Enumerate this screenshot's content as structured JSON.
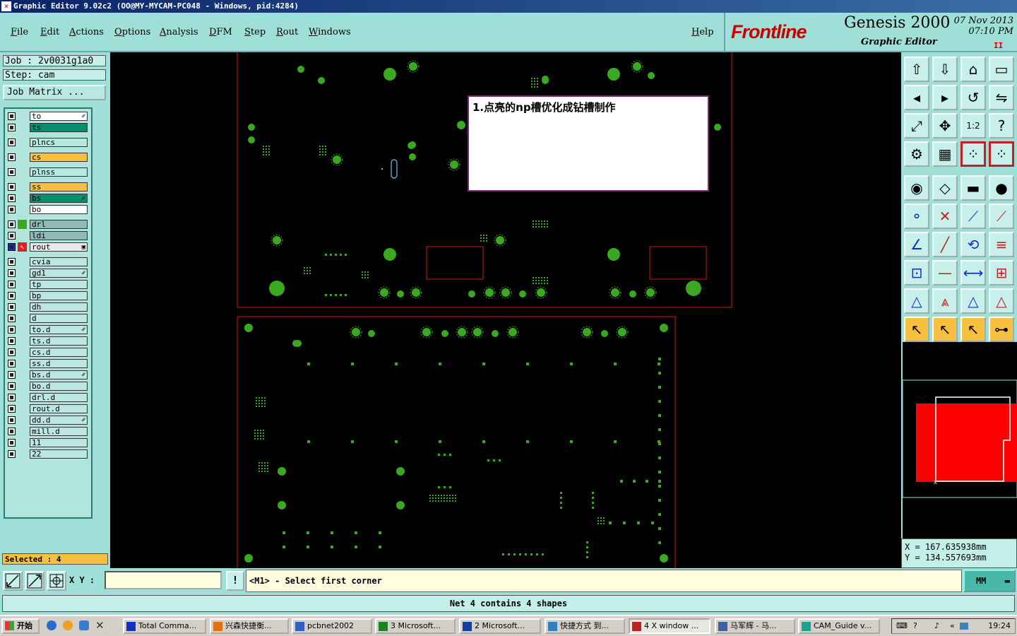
{
  "window": {
    "title": "Graphic Editor 9.02c2 (OO@MY-MYCAM-PC048 - Windows, pid:4284)"
  },
  "menu": {
    "items": [
      "File",
      "Edit",
      "Actions",
      "Options",
      "Analysis",
      "DFM",
      "Step",
      "Rout",
      "Windows"
    ],
    "help": "Help"
  },
  "logo": {
    "brand": "Frontline",
    "product": "Genesis 2000",
    "subtitle": "Graphic Editor",
    "date": "07 Nov 2013",
    "time": "07:10 PM",
    "pause": "II"
  },
  "job": {
    "job_label": "Job : 2v0031g1a0",
    "step_label": "Step: cam",
    "matrix_button": "Job Matrix ..."
  },
  "layers": [
    {
      "name": "to",
      "color": "#ffffff",
      "mark": "✐"
    },
    {
      "name": "ts",
      "color": "#009070",
      "mark": ""
    },
    {
      "name": "plncs",
      "color": "#b8e8e0",
      "mark": ""
    },
    {
      "name": "cs",
      "color": "#f8c040",
      "mark": ""
    },
    {
      "name": "plnss",
      "color": "#b8e8e0",
      "mark": ""
    },
    {
      "name": "ss",
      "color": "#f8c040",
      "mark": ""
    },
    {
      "name": "bs",
      "color": "#009070",
      "mark": "✐"
    },
    {
      "name": "bo",
      "color": "#ffffff",
      "mark": ""
    },
    {
      "name": "drl",
      "color": "#90b8b8",
      "mark": ""
    },
    {
      "name": "ldi",
      "color": "#90b8b8",
      "mark": ""
    },
    {
      "name": "rout",
      "color": "#e8e8e8",
      "mark": "▣"
    },
    {
      "name": "cvia",
      "color": "#b8e8e0",
      "mark": ""
    },
    {
      "name": "gd1",
      "color": "#b8e8e0",
      "mark": "✐"
    },
    {
      "name": "tp",
      "color": "#b8e8e0",
      "mark": ""
    },
    {
      "name": "bp",
      "color": "#b8e8e0",
      "mark": ""
    },
    {
      "name": "dh",
      "color": "#b8e8e0",
      "mark": ""
    },
    {
      "name": "d",
      "color": "#b8e8e0",
      "mark": ""
    },
    {
      "name": "to.d",
      "color": "#b8e8e0",
      "mark": "✐"
    },
    {
      "name": "ts.d",
      "color": "#b8e8e0",
      "mark": ""
    },
    {
      "name": "cs.d",
      "color": "#b8e8e0",
      "mark": ""
    },
    {
      "name": "ss.d",
      "color": "#b8e8e0",
      "mark": ""
    },
    {
      "name": "bs.d",
      "color": "#b8e8e0",
      "mark": "✐"
    },
    {
      "name": "bo.d",
      "color": "#b8e8e0",
      "mark": ""
    },
    {
      "name": "drl.d",
      "color": "#b8e8e0",
      "mark": ""
    },
    {
      "name": "rout.d",
      "color": "#b8e8e0",
      "mark": ""
    },
    {
      "name": "dd.d",
      "color": "#b8e8e0",
      "mark": "✐"
    },
    {
      "name": "mill.d",
      "color": "#b8e8e0",
      "mark": ""
    },
    {
      "name": "11",
      "color": "#b8e8e0",
      "mark": ""
    },
    {
      "name": "22",
      "color": "#b8e8e0",
      "mark": ""
    }
  ],
  "selected": "Selected : 4",
  "note": "1.点亮的np槽优化成钻槽制作",
  "coords": {
    "x": "X = 167.635938mm",
    "y": "Y = 134.557693mm"
  },
  "bottom": {
    "xy_label": "X Y :",
    "xy_value": "",
    "msg_button": "!",
    "prompt": "<M1> - Select first corner",
    "units": "MM"
  },
  "status": "Net 4 contains 4 shapes",
  "taskbar": {
    "start": "开始",
    "tasks": [
      "Total Comma...",
      "兴森快捷衡...",
      "pcbnet2002",
      "3 Microsoft...",
      "2 Microsoft...",
      "快捷方式 到...",
      "4 X window ...",
      "马军辉 - 马...",
      "CAM_Guide v..."
    ],
    "clock": "19:24"
  },
  "colors": {
    "accent": "#9ee0d8",
    "pad": "#3aa820",
    "outline": "#d01818"
  }
}
